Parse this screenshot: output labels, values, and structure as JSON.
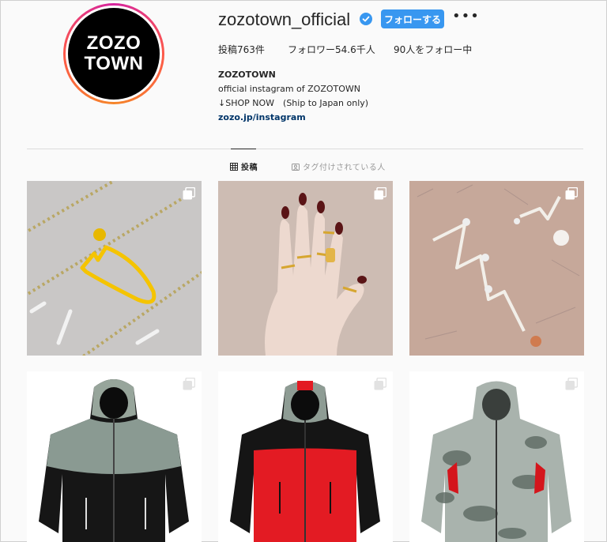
{
  "profile": {
    "avatar_line1": "ZOZO",
    "avatar_line2": "TOWN",
    "username": "zozotown_official",
    "follow_label": "フォローする",
    "more_label": "•••",
    "stats": {
      "posts": "投稿763件",
      "followers": "フォロワー54.6千人",
      "following": "90人をフォロー中"
    },
    "bio": {
      "name": "ZOZOTOWN",
      "line1": "official instagram of ZOZOTOWN",
      "line2": "↓SHOP NOW　(Ship to Japan only)",
      "link": "zozo.jp/instagram"
    }
  },
  "tabs": [
    {
      "label": "投稿",
      "icon": "grid-icon"
    },
    {
      "label": "タグ付けされている人",
      "icon": "tag-person-icon"
    }
  ],
  "colors": {
    "accent": "#3897f0",
    "link": "#003569",
    "verified": "#3897f0"
  },
  "posts": [
    {
      "subject": "gold-ring",
      "icon": "carousel-icon"
    },
    {
      "subject": "hand-with-rings",
      "icon": "carousel-icon"
    },
    {
      "subject": "zigzag-earrings",
      "icon": "carousel-icon"
    },
    {
      "subject": "black-camo-jacket",
      "icon": "carousel-icon"
    },
    {
      "subject": "red-camo-jacket",
      "icon": "carousel-icon"
    },
    {
      "subject": "camo-jacket",
      "icon": "carousel-icon"
    }
  ]
}
